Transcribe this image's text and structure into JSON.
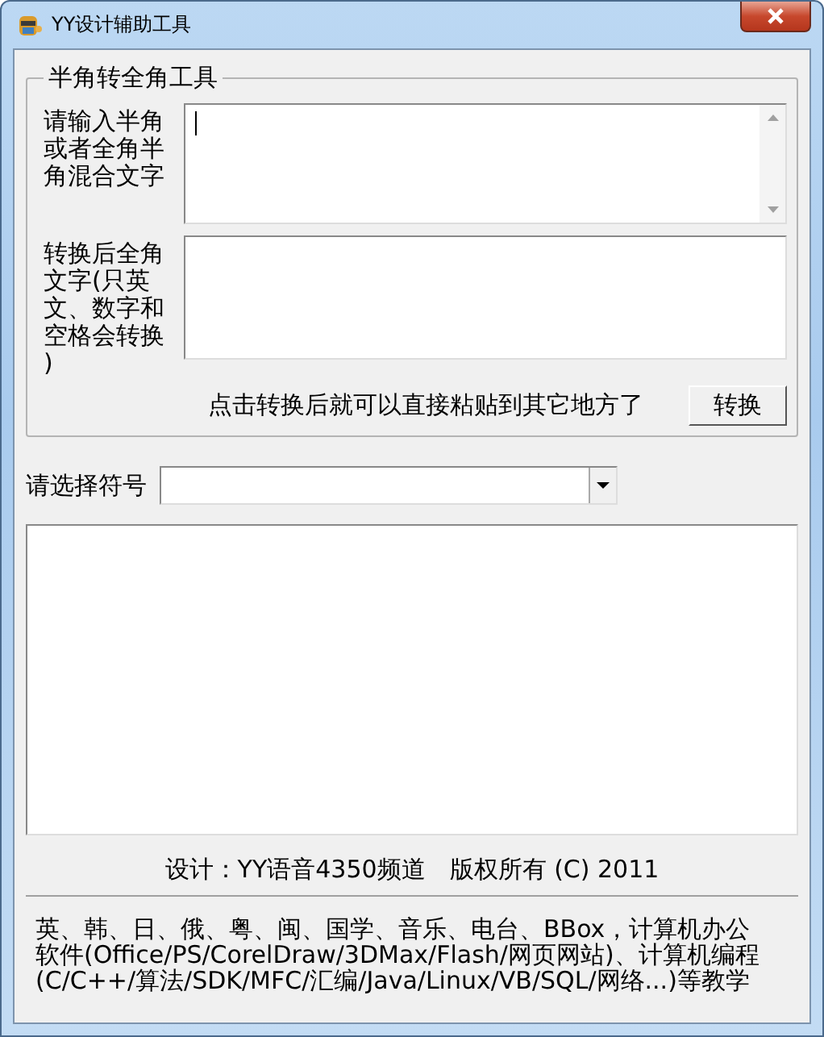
{
  "window": {
    "title": "YY设计辅助工具"
  },
  "converter": {
    "title": "半角转全角工具",
    "input_label": "请输入半角或者全角半角混合文字",
    "input_focused": true,
    "output_label": "转换后全角文字(只英文、数字和空格会转换)",
    "hint": "点击转换后就可以直接粘贴到其它地方了",
    "convert_button": "转换"
  },
  "symbol_picker": {
    "label": "请选择符号"
  },
  "credit": "设计：YY语音4350频道　版权所有 (C) 2011",
  "description": "英、韩、日、俄、粤、闽、国学、音乐、电台、BBox，计算机办公软件(Office/PS/CorelDraw/3DMax/Flash/网页网站)、计算机编程(C/C++/算法/SDK/MFC/汇编/Java/Linux/VB/SQL/网络...)等教学"
}
